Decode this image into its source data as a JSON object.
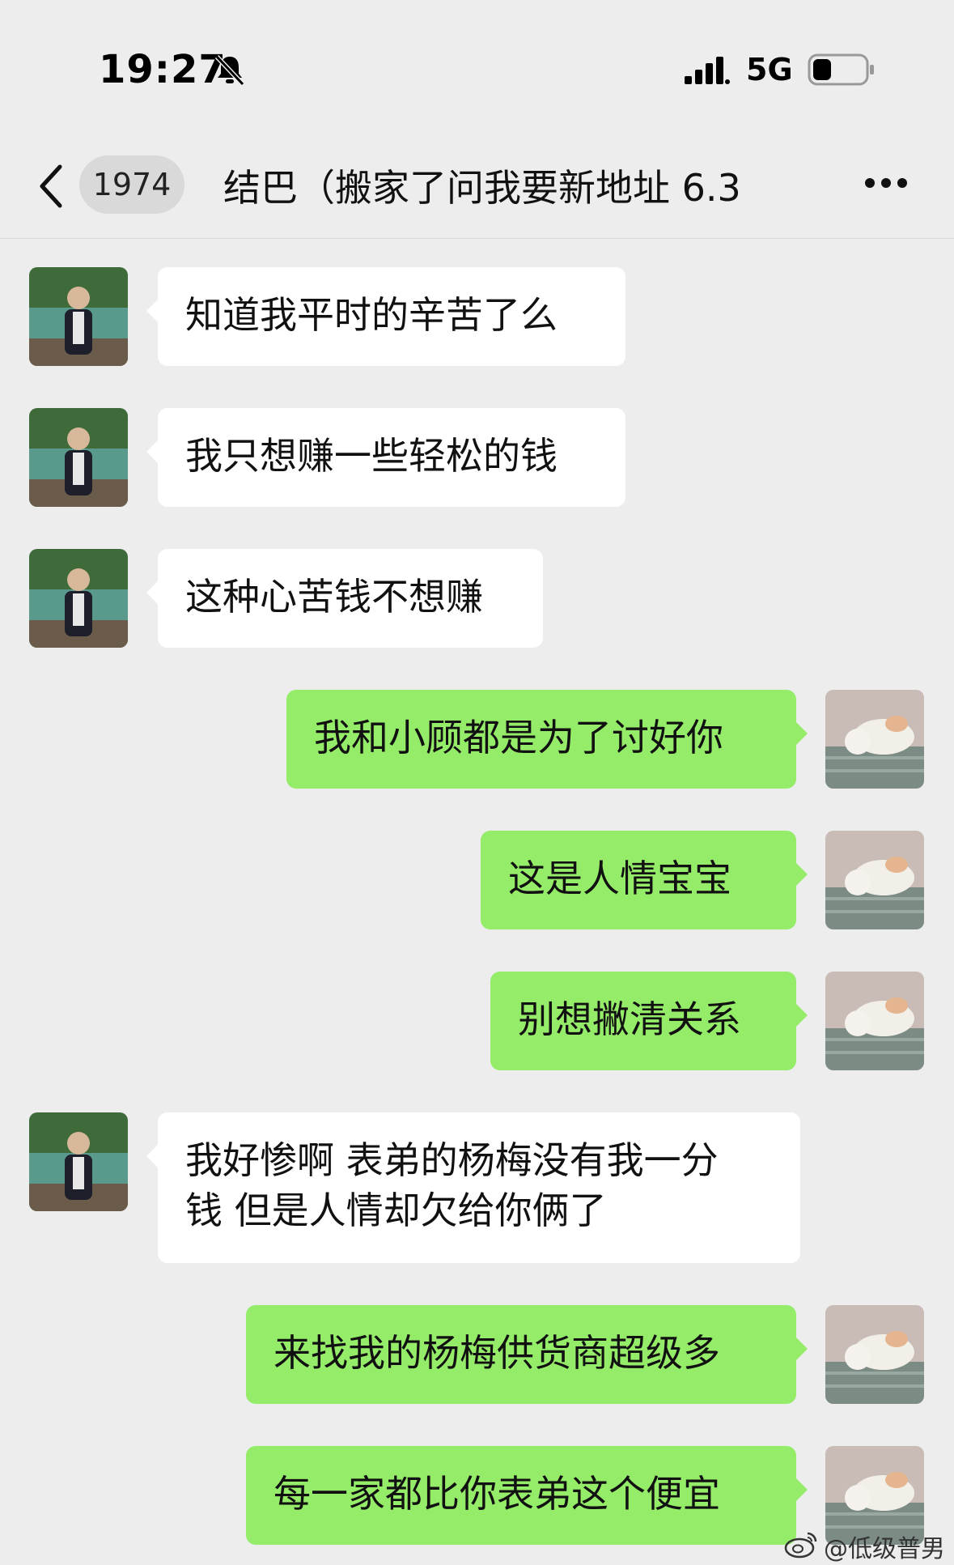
{
  "status_bar": {
    "time": "19:27",
    "network": "5G",
    "icons": [
      "bell-muted-icon",
      "signal-icon",
      "battery-icon"
    ]
  },
  "nav": {
    "back_icon": "chevron-left-icon",
    "unread_count": "1974",
    "title": "结巴（搬家了问我要新地址 6.3",
    "more_icon": "more-dots-icon"
  },
  "colors": {
    "background": "#ededed",
    "incoming_bubble": "#ffffff",
    "outgoing_bubble": "#95ec69"
  },
  "messages": [
    {
      "direction": "incoming",
      "text": "知道我平时的辛苦了么"
    },
    {
      "direction": "incoming",
      "text": "我只想赚一些轻松的钱"
    },
    {
      "direction": "incoming",
      "text": "这种心苦钱不想赚"
    },
    {
      "direction": "outgoing",
      "text": "我和小顾都是为了讨好你"
    },
    {
      "direction": "outgoing",
      "text": "这是人情宝宝"
    },
    {
      "direction": "outgoing",
      "text": "别想撇清关系"
    },
    {
      "direction": "incoming",
      "text": "我好惨啊 表弟的杨梅没有我一分\n钱 但是人情却欠给你俩了"
    },
    {
      "direction": "outgoing",
      "text": "来找我的杨梅供货商超级多"
    },
    {
      "direction": "outgoing",
      "text": "每一家都比你表弟这个便宜"
    }
  ],
  "watermark": {
    "icon": "weibo-icon",
    "text": "@低级普男"
  }
}
